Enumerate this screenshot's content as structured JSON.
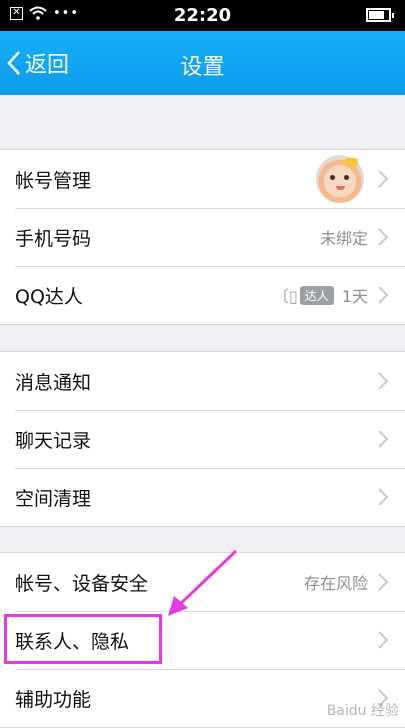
{
  "status": {
    "time": "22:20",
    "battery_level": 0.8
  },
  "nav": {
    "back_label": "返回",
    "title": "设置"
  },
  "groups": [
    {
      "rows": [
        {
          "label": "帐号管理",
          "value": ""
        },
        {
          "label": "手机号码",
          "value": "未绑定"
        },
        {
          "label": "QQ达人",
          "badge": "达人",
          "value": "1天"
        }
      ]
    },
    {
      "rows": [
        {
          "label": "消息通知",
          "value": ""
        },
        {
          "label": "聊天记录",
          "value": ""
        },
        {
          "label": "空间清理",
          "value": ""
        }
      ]
    },
    {
      "rows": [
        {
          "label": "帐号、设备安全",
          "value": "存在风险"
        },
        {
          "label": "联系人、隐私",
          "value": ""
        },
        {
          "label": "辅助功能",
          "value": ""
        }
      ]
    }
  ],
  "watermark": "Baidu 经验",
  "colors": {
    "navbar": "#0d9bea",
    "annotation": "#e23ce0",
    "background": "#efeff4"
  }
}
